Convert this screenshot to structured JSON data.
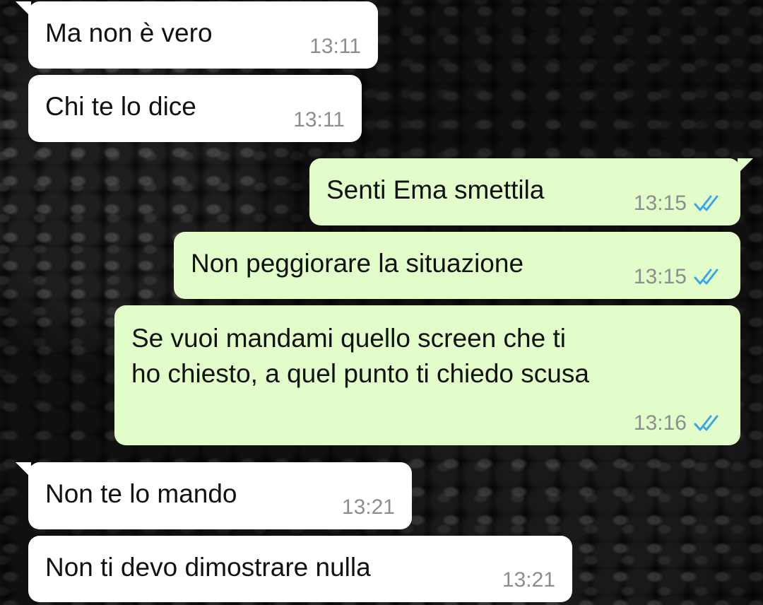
{
  "colors": {
    "incoming_bubble": "#ffffff",
    "outgoing_bubble": "#e2fdc9",
    "timestamp": "#8d8d8d",
    "read_ticks": "#3ba6e6"
  },
  "messages": [
    {
      "direction": "incoming",
      "text": "Ma non è vero",
      "time": "13:11"
    },
    {
      "direction": "incoming",
      "text": "Chi te lo dice",
      "time": "13:11"
    },
    {
      "direction": "outgoing",
      "text": "Senti Ema smettila",
      "time": "13:15",
      "status_icon": "double-check-read-icon"
    },
    {
      "direction": "outgoing",
      "text": "Non peggiorare la situazione",
      "time": "13:15",
      "status_icon": "double-check-read-icon"
    },
    {
      "direction": "outgoing",
      "text": "Se vuoi mandami quello screen che ti\nho chiesto, a quel punto ti chiedo scusa",
      "time": "13:16",
      "status_icon": "double-check-read-icon"
    },
    {
      "direction": "incoming",
      "text": "Non te lo mando",
      "time": "13:21"
    },
    {
      "direction": "incoming",
      "text": "Non ti devo dimostrare nulla",
      "time": "13:21"
    }
  ]
}
